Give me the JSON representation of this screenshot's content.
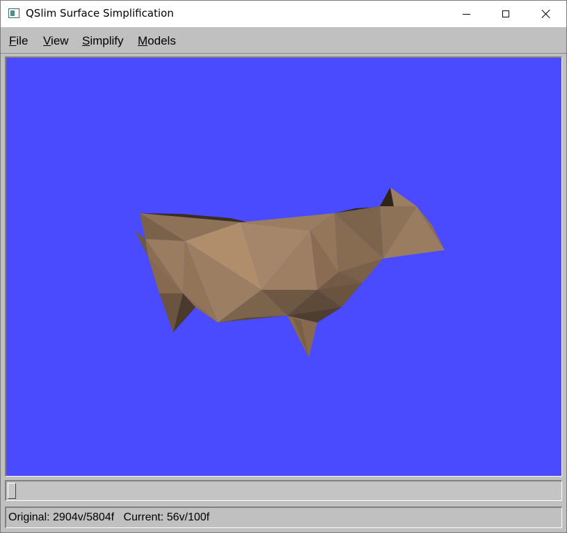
{
  "window": {
    "title": "QSlim Surface Simplification"
  },
  "menubar": {
    "items": [
      {
        "label": "File",
        "accel": "F",
        "rest": "ile"
      },
      {
        "label": "View",
        "accel": "V",
        "rest": "iew"
      },
      {
        "label": "Simplify",
        "accel": "S",
        "rest": "implify"
      },
      {
        "label": "Models",
        "accel": "M",
        "rest": "odels"
      }
    ]
  },
  "viewport": {
    "background_color": "#4a4aff",
    "model_color": "#9c8064"
  },
  "slider": {
    "value": 0
  },
  "status": {
    "original_label": "Original:",
    "original_value": "2904v/5804f",
    "current_label": "Current:",
    "current_value": "56v/100f"
  },
  "icons": {
    "app": "app-window-icon",
    "minimize": "minimize-icon",
    "maximize": "maximize-icon",
    "close": "close-icon"
  }
}
